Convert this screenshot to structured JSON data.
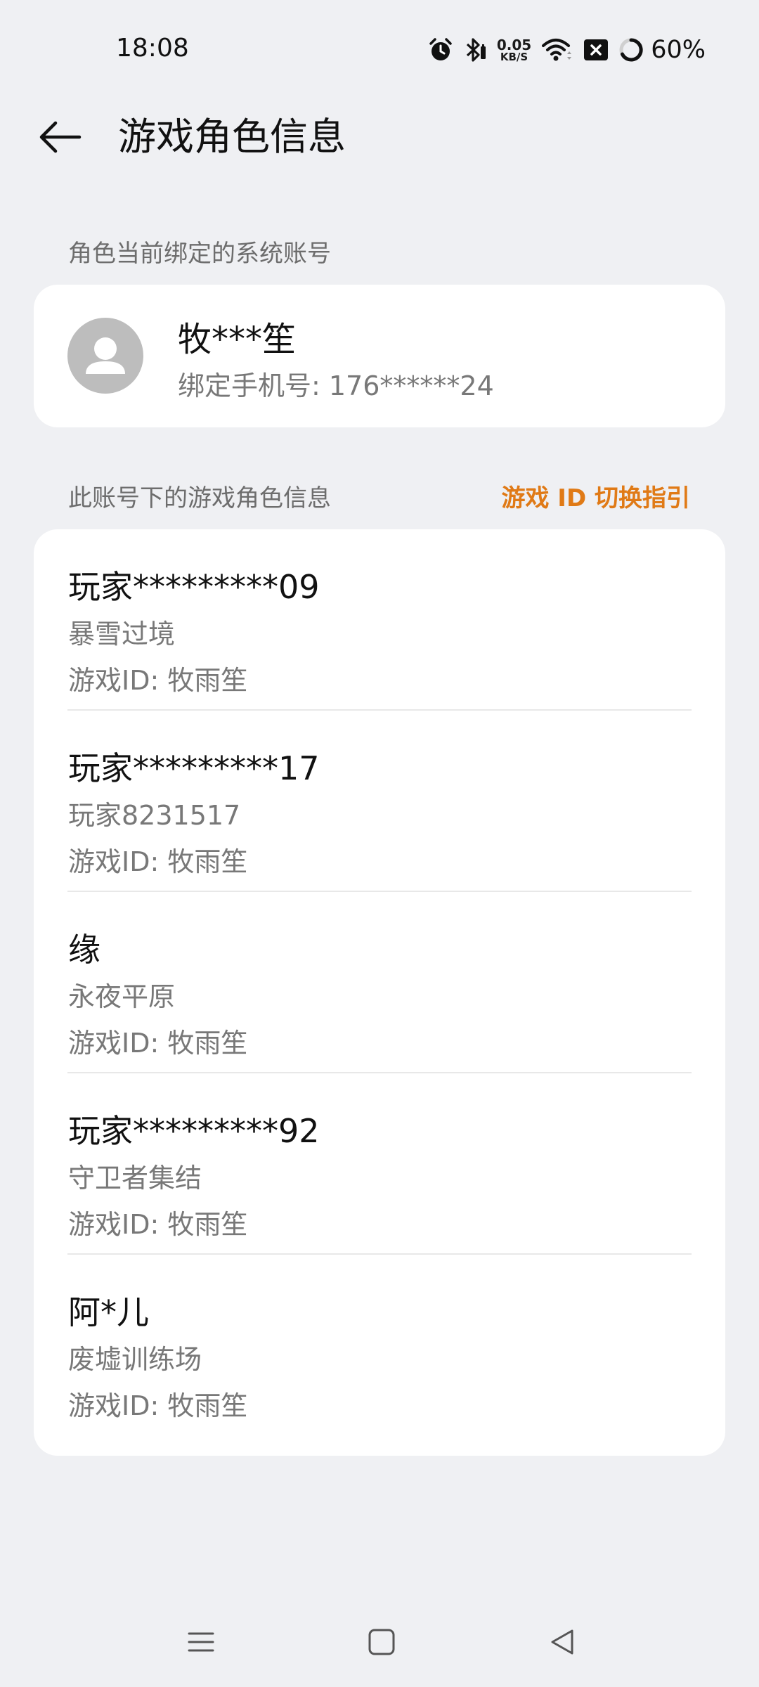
{
  "status_bar": {
    "time": "18:08",
    "net_speed_value": "0.05",
    "net_speed_unit": "KB/S",
    "battery": "60%",
    "icons": [
      "alarm-icon",
      "bluetooth-icon",
      "network-speed",
      "wifi-icon",
      "sim-icon",
      "battery-ring-icon"
    ]
  },
  "header": {
    "back_icon": "arrow-left-icon",
    "title": "游戏角色信息"
  },
  "account_section": {
    "label": "角色当前绑定的系统账号",
    "avatar_icon": "person-icon",
    "name": "牧***笙",
    "phone": "绑定手机号: 176******24"
  },
  "roles_section": {
    "label": "此账号下的游戏角色信息",
    "guide_link": "游戏 ID 切换指引",
    "guide_color": "#e07a16",
    "roles": [
      {
        "name": "玩家*********09",
        "server": "暴雪过境",
        "game_id": "游戏ID: 牧雨笙"
      },
      {
        "name": "玩家*********17",
        "server": "玩家8231517",
        "game_id": "游戏ID: 牧雨笙"
      },
      {
        "name": "缘",
        "server": "永夜平原",
        "game_id": "游戏ID: 牧雨笙"
      },
      {
        "name": "玩家*********92",
        "server": "守卫者集结",
        "game_id": "游戏ID: 牧雨笙"
      },
      {
        "name": "阿*儿",
        "server": "废墟训练场",
        "game_id": "游戏ID: 牧雨笙"
      }
    ]
  },
  "nav_bar": {
    "icons": [
      "menu-icon",
      "home-square-icon",
      "back-triangle-icon"
    ]
  }
}
